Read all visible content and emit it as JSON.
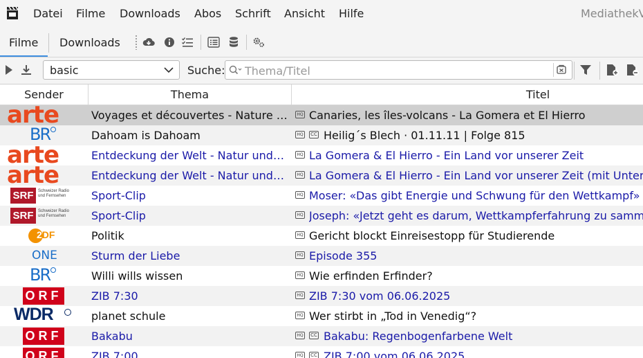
{
  "window": {
    "title": "MediathekView"
  },
  "menu": [
    "Datei",
    "Filme",
    "Downloads",
    "Abos",
    "Schrift",
    "Ansicht",
    "Hilfe"
  ],
  "tabs": {
    "filme": "Filme",
    "downloads": "Downloads"
  },
  "filterbar": {
    "filter_value": "basic",
    "search_label": "Suche:",
    "search_placeholder": "Thema/Titel"
  },
  "table": {
    "headers": {
      "sender": "Sender",
      "thema": "Thema",
      "titel": "Titel"
    },
    "rows": [
      {
        "sender": "arte",
        "thema": "Voyages et découvertes - Nature et environnement",
        "titel": "Canaries, les îles-volcans - La Gomera et El Hierro",
        "cc": false,
        "color": "black",
        "selected": true
      },
      {
        "sender": "BR",
        "thema": "Dahoam is Dahoam",
        "titel": "Heilig´s Blech · 01.11.11 | Folge 815",
        "cc": true,
        "color": "black",
        "selected": false
      },
      {
        "sender": "arte",
        "thema": "Entdeckung der Welt - Natur und Umwelt",
        "titel": "La Gomera & El Hierro - Ein Land vor unserer Zeit",
        "cc": false,
        "color": "blue",
        "selected": false
      },
      {
        "sender": "arte",
        "thema": "Entdeckung der Welt - Natur und Umwelt",
        "titel": "La Gomera & El Hierro - Ein Land vor unserer Zeit (mit Untertiteln)",
        "cc": false,
        "color": "blue",
        "selected": false
      },
      {
        "sender": "SRF",
        "thema": "Sport-Clip",
        "titel": "Moser: «Das gibt Energie und Schwung für den Wettkampf»",
        "cc": false,
        "color": "blue",
        "selected": false
      },
      {
        "sender": "SRF",
        "thema": "Sport-Clip",
        "titel": "Joseph: «Jetzt geht es darum, Wettkampferfahrung zu sammeln»",
        "cc": false,
        "color": "blue",
        "selected": false
      },
      {
        "sender": "ZDF",
        "thema": "Politik",
        "titel": "Gericht blockt Einreisestopp für Studierende",
        "cc": false,
        "color": "black",
        "selected": false
      },
      {
        "sender": "ONE",
        "thema": "Sturm der Liebe",
        "titel": "Episode 355",
        "cc": false,
        "color": "blue",
        "selected": false
      },
      {
        "sender": "BR",
        "thema": "Willi wills wissen",
        "titel": "Wie erfinden Erfinder?",
        "cc": false,
        "color": "black",
        "selected": false
      },
      {
        "sender": "ORF",
        "thema": "ZIB 7:30",
        "titel": "ZIB 7:30 vom 06.06.2025",
        "cc": false,
        "color": "blue",
        "selected": false
      },
      {
        "sender": "WDR",
        "thema": "planet schule",
        "titel": "Wer stirbt in „Tod in Venedig“?",
        "cc": false,
        "color": "black",
        "selected": false
      },
      {
        "sender": "ORF",
        "thema": "Bakabu",
        "titel": "Bakabu: Regenbogenfarbene Welt",
        "cc": true,
        "color": "blue",
        "selected": false
      },
      {
        "sender": "ORF",
        "thema": "ZIB 7:00",
        "titel": "ZIB 7:00 vom 06.06.2025",
        "cc": true,
        "color": "blue",
        "selected": false
      }
    ]
  },
  "logos": {
    "arte": "arte",
    "br": "BR",
    "srf": "SRF",
    "srf_sub": [
      "Schweizer Radio",
      "und Fernsehen"
    ],
    "zdf": [
      "2",
      "DF"
    ],
    "one": "ONE",
    "orf": "ORF",
    "wdr": "WDR"
  },
  "badges": {
    "hq": "HQ",
    "cc": "CC"
  },
  "colors": {
    "link": "#1a1aa8",
    "selected": "#cfcfcf",
    "alt_row": "#f2f2f2",
    "accent": "#3d8ee0"
  }
}
